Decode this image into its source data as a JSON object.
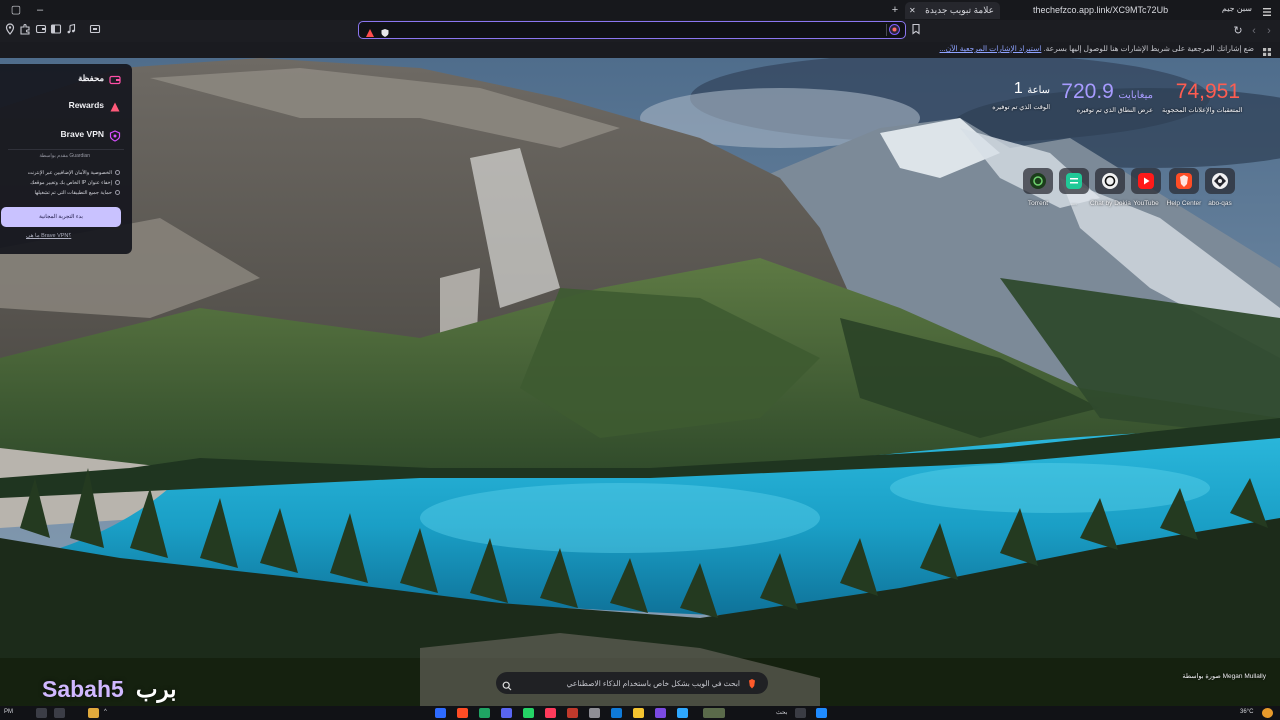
{
  "window": {
    "profile_name": "سبن جيم",
    "menu_icon": "hamburger-icon",
    "restore_label": "▢",
    "minimize_label": "–",
    "close_label": "✕"
  },
  "tabs": [
    {
      "label": "علامة تبويب جديدة",
      "close": "✕",
      "active": true
    },
    {
      "label": "thechefzco.app.link/XC9MTc72Ub",
      "active": false
    }
  ],
  "new_tab_label": "+",
  "toolbar": {
    "url_value": "",
    "url_placeholder": "",
    "reload_label": "↻",
    "back_label": "‹",
    "forward_label": "›"
  },
  "bookmarks_bar": {
    "message": "ضع إشاراتك المرجعية على شريط الإشارات هنا للوصول إليها بسرعة.",
    "link": "استيراد الإشارات المرجعية الآن..."
  },
  "panel": {
    "rows": [
      {
        "label": "محفظة",
        "icon": "wallet-icon"
      },
      {
        "label": "Rewards",
        "icon": "rewards-triangle-icon"
      },
      {
        "label": "Brave VPN",
        "icon": "vpn-icon"
      }
    ],
    "guardian": "مقدم بواسطة Guardian",
    "features": [
      "الخصوصية والأمان الإضافيين عبر الإنترنت",
      "إخفاء عنوان IP الخاص بك وتغيير موقعك",
      "حماية جميع التطبيقات التي تم تشغيلها"
    ],
    "trial_button": "بدء التجربة المجانية",
    "vpn_link": "ما هي Brave VPN؟"
  },
  "stats": [
    {
      "value": "74,951",
      "unit": "",
      "caption": "المتعقبات والإعلانات المحجوبة",
      "color": "#ff5d51"
    },
    {
      "value": "720.9",
      "unit": "ميغابايت",
      "caption": "عرض النطاق الذي تم توفيره",
      "color": "#a79bff"
    },
    {
      "value": "1",
      "unit": "ساعة",
      "caption": "الوقت الذي تم توفيره",
      "color": "#ffffff"
    }
  ],
  "top_sites": [
    {
      "label": "abo-qas",
      "icon": "brave-talk-icon",
      "color": "#23252d"
    },
    {
      "label": "Help Center",
      "icon": "brave-lion-icon",
      "color": "#ff4d25"
    },
    {
      "label": "YouTube",
      "icon": "youtube-icon",
      "color": "#ff1a1a"
    },
    {
      "label": "Chat by Dokia",
      "icon": "chatgpt-icon",
      "color": "#f2f2f2"
    },
    {
      "label": "…",
      "icon": "green-grid-icon",
      "color": "#20c997"
    },
    {
      "label": "Torrent",
      "icon": "torrent-icon",
      "color": "#1b3d1b"
    }
  ],
  "search": {
    "placeholder": "ابحث في الويب بشكل خاص باستخدام الذكاء الاصطناعي",
    "value": ""
  },
  "photo_credit": "صورة بواسطة Megan Mullally",
  "watermark": {
    "latin": "Sabah5",
    "arabic": "برب"
  },
  "taskbar": {
    "weather": "36°C",
    "search_label": "بحث",
    "time": "PM"
  }
}
